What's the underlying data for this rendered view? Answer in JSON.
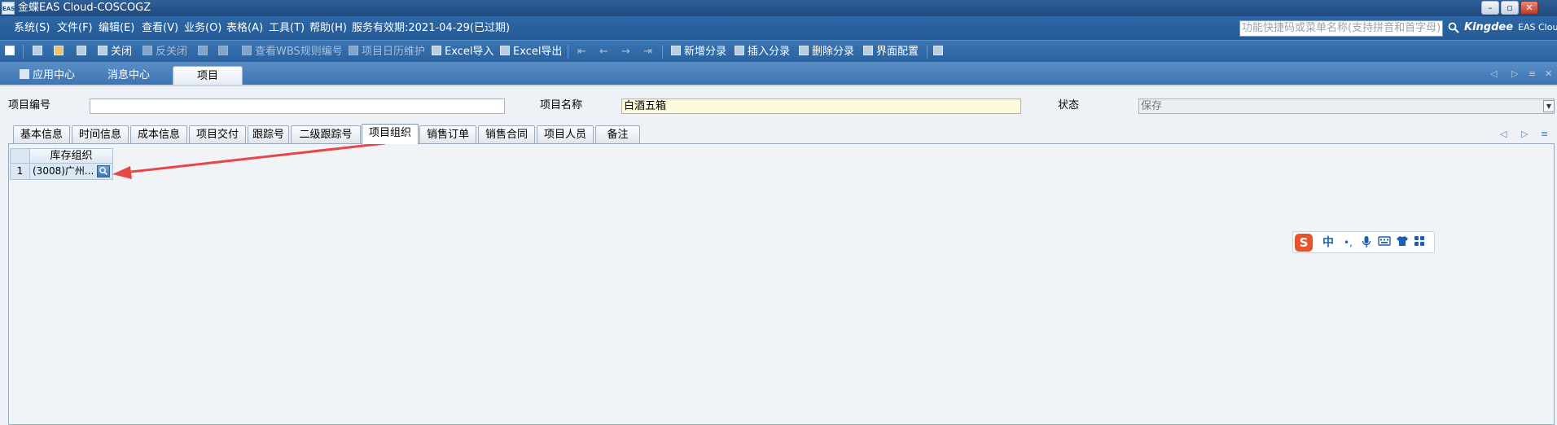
{
  "window": {
    "title": "金蝶EAS Cloud-COSCOGZ",
    "app_icon": "EAS",
    "controls": [
      "–",
      "▫",
      "✕"
    ]
  },
  "menu": {
    "items": [
      "系统(S)",
      "文件(F)",
      "编辑(E)",
      "查看(V)",
      "业务(O)",
      "表格(A)",
      "工具(T)",
      "帮助(H)"
    ],
    "service_status": "服务有效期:2021-04-29(已过期)",
    "search_placeholder": "功能快捷码或菜单名称(支持拼音和首字母)",
    "brand_name": "Kingdee",
    "brand_product": "EAS Clou"
  },
  "toolbar": {
    "close": "关闭",
    "unclose": "反关闭",
    "view_wbs": "查看WBS规则编号",
    "calendar": "项目日历维护",
    "excel_import": "Excel导入",
    "excel_export": "Excel导出",
    "add_entry": "新增分录",
    "insert_entry": "插入分录",
    "delete_entry": "删除分录",
    "ui_config": "界面配置"
  },
  "tabs": {
    "app_center": "应用中心",
    "message_center": "消息中心",
    "project": "项目"
  },
  "form": {
    "project_code_label": "项目编号",
    "project_code_value": "",
    "project_name_label": "项目名称",
    "project_name_value": "白酒五箱",
    "status_label": "状态",
    "status_value": "保存"
  },
  "subtabs": [
    "基本信息",
    "时间信息",
    "成本信息",
    "项目交付",
    "跟踪号",
    "二级跟踪号",
    "项目组织",
    "销售订单",
    "销售合同",
    "项目人员",
    "备注"
  ],
  "subtabs_active": "项目组织",
  "grid": {
    "column_header": "库存组织",
    "rows": [
      {
        "num": "1",
        "value": "(3008)广州..."
      }
    ]
  },
  "ime": {
    "logo": "S",
    "mode": "中",
    "punct": "•,"
  },
  "colors": {
    "titlebar": "#1f4a7e",
    "menubar": "#2d67a6",
    "annotation_arrow": "#e8474a",
    "yellow_field": "#fdfbdc"
  }
}
